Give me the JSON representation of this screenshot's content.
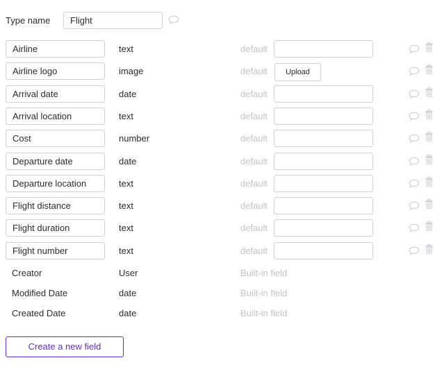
{
  "type_name": {
    "label": "Type name",
    "value": "Flight",
    "comment_icon": "comment-icon"
  },
  "placeholders": {
    "default": "default",
    "built_in": "Built-in field",
    "upload": "Upload"
  },
  "fields": [
    {
      "name": "Airline",
      "type": "text",
      "default_kind": "input"
    },
    {
      "name": "Airline logo",
      "type": "image",
      "default_kind": "upload"
    },
    {
      "name": "Arrival date",
      "type": "date",
      "default_kind": "input"
    },
    {
      "name": "Arrival location",
      "type": "text",
      "default_kind": "input"
    },
    {
      "name": "Cost",
      "type": "number",
      "default_kind": "input"
    },
    {
      "name": "Departure date",
      "type": "date",
      "default_kind": "input"
    },
    {
      "name": "Departure location",
      "type": "text",
      "default_kind": "input"
    },
    {
      "name": "Flight distance",
      "type": "text",
      "default_kind": "input"
    },
    {
      "name": "Flight duration",
      "type": "text",
      "default_kind": "input"
    },
    {
      "name": "Flight number",
      "type": "text",
      "default_kind": "input"
    }
  ],
  "built_in_fields": [
    {
      "name": "Creator",
      "type": "User"
    },
    {
      "name": "Modified Date",
      "type": "date"
    },
    {
      "name": "Created Date",
      "type": "date"
    }
  ],
  "create_button_label": "Create a new field",
  "colors": {
    "accent": "#5e2bd4",
    "muted_text": "#c3c3c3",
    "icon": "#c8cfd6"
  }
}
